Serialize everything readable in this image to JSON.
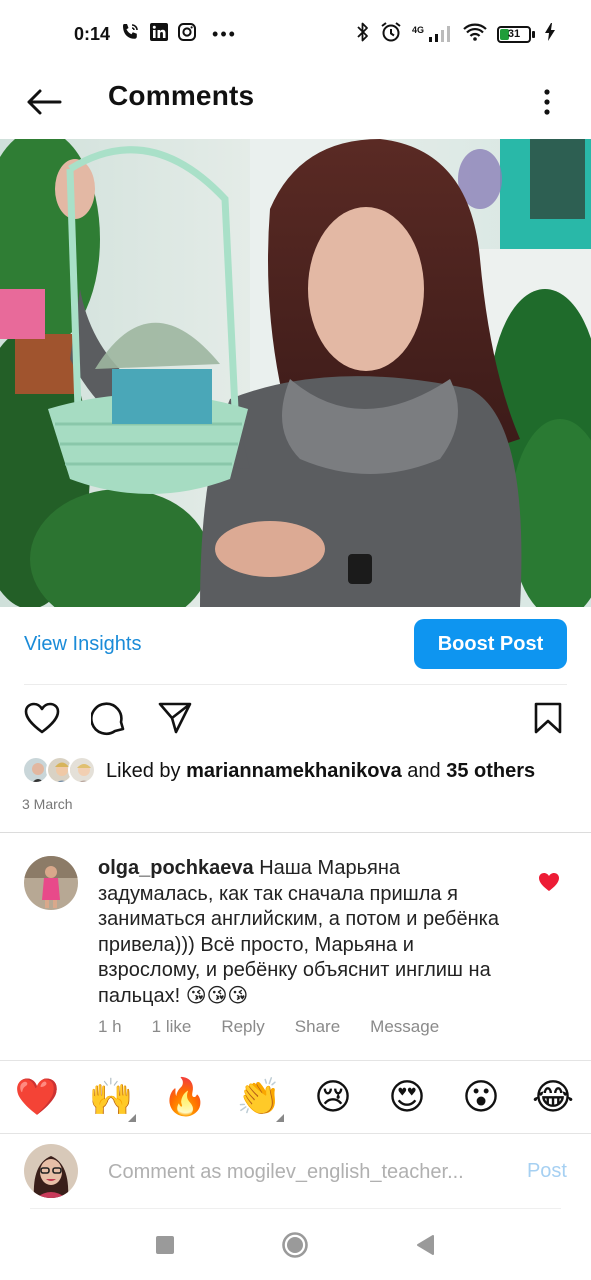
{
  "status_bar": {
    "time": "0:14",
    "network": "4G",
    "battery": "31"
  },
  "header": {
    "title": "Comments"
  },
  "post": {
    "insights_label": "View Insights",
    "boost_label": "Boost Post",
    "liked_by_prefix": "Liked by ",
    "liked_by_user": "mariannamekhanikova",
    "liked_by_and": " and ",
    "liked_by_others": "35 others",
    "date": "3 March"
  },
  "comment": {
    "username": "olga_pochkaeva",
    "text": "Наша Марьяна задумалась, как так сначала пришла я заниматься английским, а потом и ребёнка привела))) Всё просто, Марьяна и взрослому, и ребёнку объяснит инглиш на пальцах! 😘😘😘",
    "time": "1 h",
    "likes": "1 like",
    "reply": "Reply",
    "share": "Share",
    "message": "Message"
  },
  "quick_reactions": [
    "❤️",
    "🙌",
    "🔥",
    "👏",
    "😢",
    "😍",
    "😮",
    "😂"
  ],
  "composer": {
    "placeholder": "Comment as mogilev_english_teacher...",
    "post_label": "Post"
  },
  "colors": {
    "accent": "#0e95f0",
    "link": "#1a8bd8",
    "heart": "#ed1c35"
  }
}
